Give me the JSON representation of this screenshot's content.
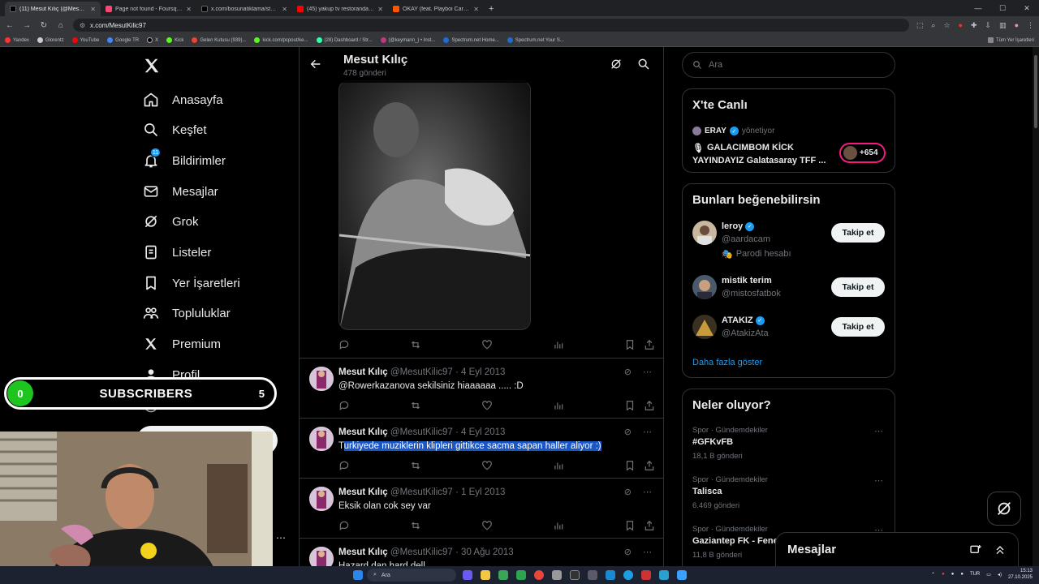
{
  "browser": {
    "tabs": [
      {
        "title": "(11) Mesut Kılıç (@MesutKilic97)",
        "color": "#000000",
        "active": true
      },
      {
        "title": "Page not found - Foursquare",
        "color": "#f94877",
        "active": false
      },
      {
        "title": "x.com/bosunatiklama/status/1!",
        "color": "#000000",
        "active": false
      },
      {
        "title": "(45) yakup tv restorandan hesa",
        "color": "#ff0000",
        "active": false
      },
      {
        "title": "OKAY (feat. Playboi Carti &",
        "color": "#ff5500",
        "active": false
      }
    ],
    "url": "x.com/MesutKilic97",
    "bookmarks": [
      "Yandex",
      "Glorentz",
      "YouTube",
      "Google TR",
      "X",
      "Kick",
      "Gelen Kutusu (939)...",
      "kick.com/pcpout/ke...",
      "(28) Dashboard / Str...",
      "(@keymann_) • Inst...",
      "Spectrum.net Home...",
      "Spectrum.net Your S..."
    ],
    "bookmarks_right": "Tüm Yer İşaretleri"
  },
  "nav": {
    "items": [
      {
        "label": "Anasayfa",
        "icon": "home-icon"
      },
      {
        "label": "Keşfet",
        "icon": "search-icon"
      },
      {
        "label": "Bildirimler",
        "icon": "bell-icon",
        "badge": "11"
      },
      {
        "label": "Mesajlar",
        "icon": "mail-icon"
      },
      {
        "label": "Grok",
        "icon": "grok-icon"
      },
      {
        "label": "Listeler",
        "icon": "list-icon"
      },
      {
        "label": "Yer İşaretleri",
        "icon": "bookmark-icon"
      },
      {
        "label": "Topluluklar",
        "icon": "communities-icon"
      },
      {
        "label": "Premium",
        "icon": "x-logo-icon"
      },
      {
        "label": "Profil",
        "icon": "profile-icon"
      },
      {
        "label": "Daha fazla",
        "icon": "more-icon"
      }
    ]
  },
  "profile": {
    "name": "Mesut Kılıç",
    "post_count": "478 gönderi"
  },
  "tweets": [
    {
      "name": "Mesut Kılıç",
      "handle": "@MesutKilic97",
      "date": "4 Eyl 2013",
      "text_first": "@Rowerkazanova sekilsiniz hiaaaaaa ..... :D",
      "text_highlight": ""
    },
    {
      "name": "Mesut Kılıç",
      "handle": "@MesutKilic97",
      "date": "4 Eyl 2013",
      "text_first": "T",
      "text_highlight": "urkiyede muziklerin klipleri gittikce sacma sapan haller aliyor :)"
    },
    {
      "name": "Mesut Kılıç",
      "handle": "@MesutKilic97",
      "date": "1 Eyl 2013",
      "text_first": "Eksik olan cok sey var",
      "text_highlight": ""
    },
    {
      "name": "Mesut Kılıç",
      "handle": "@MesutKilic97",
      "date": "30 Ağu 2013",
      "text_first": "Hazard dan hard dell",
      "text_highlight": ""
    }
  ],
  "search": {
    "placeholder": "Ara"
  },
  "live": {
    "title": "X'te Canlı",
    "host": "ERAY",
    "host_suffix": "yönetiyor",
    "line1": "GALACIMBOM KİCK",
    "line2": "YAYINDAYIZ Galatasaray TFF ...",
    "listeners": "+654"
  },
  "suggestions": {
    "title": "Bunları beğenebilirsin",
    "follow_label": "Takip et",
    "show_more": "Daha fazla göster",
    "users": [
      {
        "name": "leroy",
        "handle": "@aardacam",
        "verified": true,
        "note": "Parodi hesabı"
      },
      {
        "name": "mistik terim",
        "handle": "@mistosfatbok",
        "verified": false,
        "note": ""
      },
      {
        "name": "ATAKIZ",
        "handle": "@AtakizAta",
        "verified": true,
        "note": ""
      }
    ]
  },
  "trends": {
    "title": "Neler oluyor?",
    "items": [
      {
        "category": "Spor · Gündemdekiler",
        "title": "#GFKvFB",
        "count": "18,1 B gönderi"
      },
      {
        "category": "Spor · Gündemdekiler",
        "title": "Talisca",
        "count": "6.469 gönderi"
      },
      {
        "category": "Spor · Gündemdekiler",
        "title": "Gaziantep FK - Fenerbahçe",
        "count": "11,8 B gönderi"
      }
    ]
  },
  "messages_drawer": {
    "title": "Mesajlar"
  },
  "overlay": {
    "sub_count": "0",
    "sub_label": "SUBSCRIBERS",
    "sub_goal": "5"
  },
  "taskbar": {
    "search": "Ara",
    "lang": "TUR",
    "time": "15:13",
    "date": "27.10.2025"
  },
  "colors": {
    "accent": "#1d9bf0",
    "highlight": "#1a56c4",
    "live_ring": "#f91880",
    "sub_green": "#1ec51e"
  }
}
